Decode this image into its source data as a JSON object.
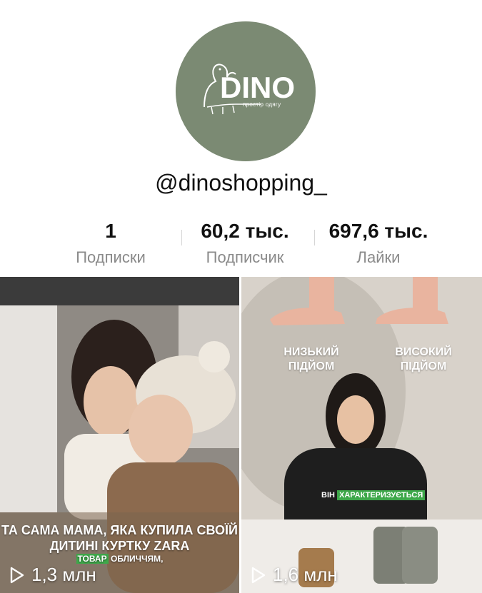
{
  "profile": {
    "logo_text": "DINO",
    "logo_subtitle": "простір одягу",
    "username": "@dinoshopping_"
  },
  "stats": [
    {
      "value": "1",
      "label": "Подписки"
    },
    {
      "value": "60,2 тыс.",
      "label": "Подписчик"
    },
    {
      "value": "697,6 тыс.",
      "label": "Лайки"
    }
  ],
  "videos": [
    {
      "caption": "ТА САМА МАМА, ЯКА КУПИЛА СВОЇЙ ДИТИНІ КУРТКУ ZARA",
      "subtitle_highlight": "ТОВАР",
      "subtitle_rest": "ОБЛИЧЧЯМ,",
      "views": "1,3 млн"
    },
    {
      "label_left": "НИЗЬКИЙ ПІДЙОМ",
      "label_right": "ВИСОКИЙ ПІДЙОМ",
      "subtitle_left": "ВІН",
      "subtitle_highlight": "ХАРАКТЕРИЗУЄТЬСЯ",
      "views": "1,6 млн"
    }
  ],
  "colors": {
    "avatar_bg": "#7b8a73",
    "highlight": "#3ea84a",
    "muted_label": "#8a8a8a"
  },
  "icons": {
    "play": "play-icon",
    "logo": "dinosaur-logo"
  }
}
